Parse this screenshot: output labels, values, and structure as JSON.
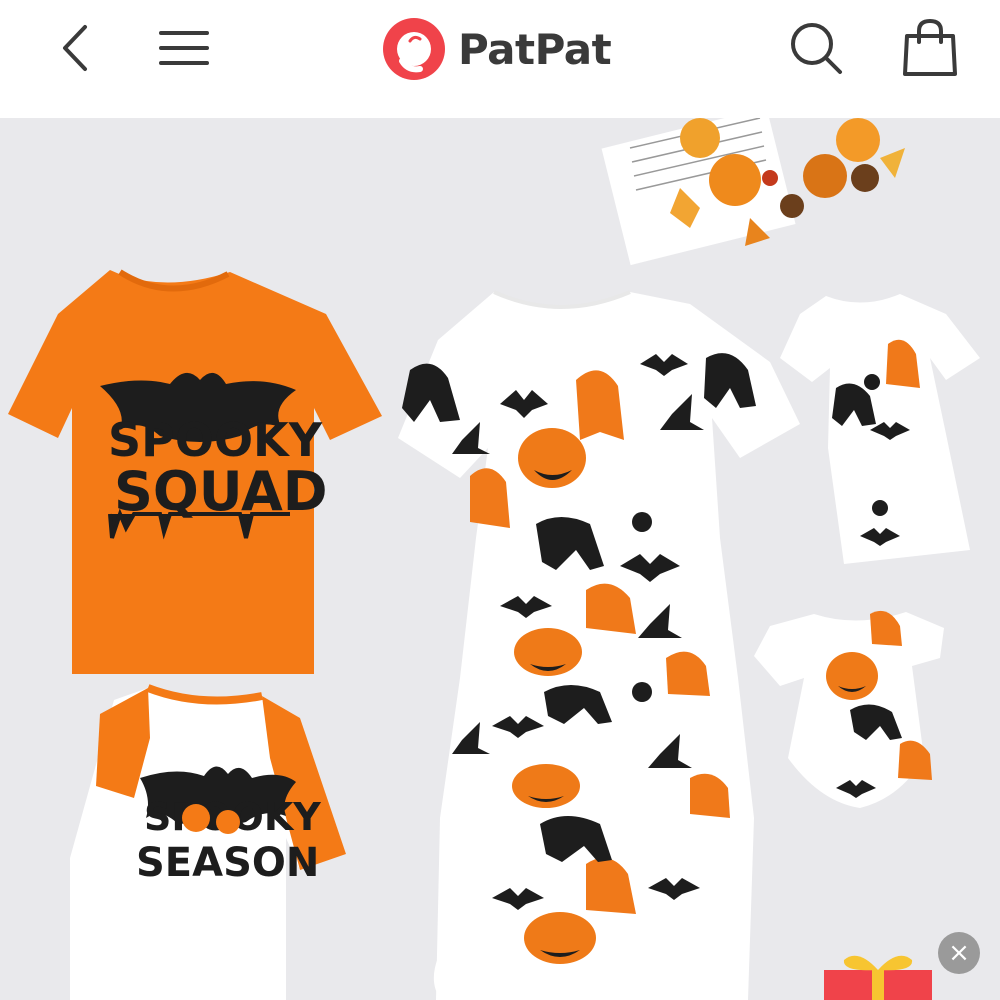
{
  "header": {
    "brand": "PatPat",
    "icons": {
      "back": "chevron-left-icon",
      "menu": "hamburger-menu-icon",
      "search": "search-icon",
      "bag": "shopping-bag-icon",
      "logo": "patpat-logo-icon"
    }
  },
  "hero": {
    "adult_tee_print": [
      "SPOOKY",
      "SQUAD"
    ],
    "kid_tee_print": [
      "SPOOKY",
      "SEASON"
    ]
  },
  "overlay": {
    "close_label": "×"
  },
  "colors": {
    "brand_red": "#f0434a",
    "orange": "#f47a16",
    "background": "#e9e9ec",
    "ink": "#1d1d1d"
  }
}
